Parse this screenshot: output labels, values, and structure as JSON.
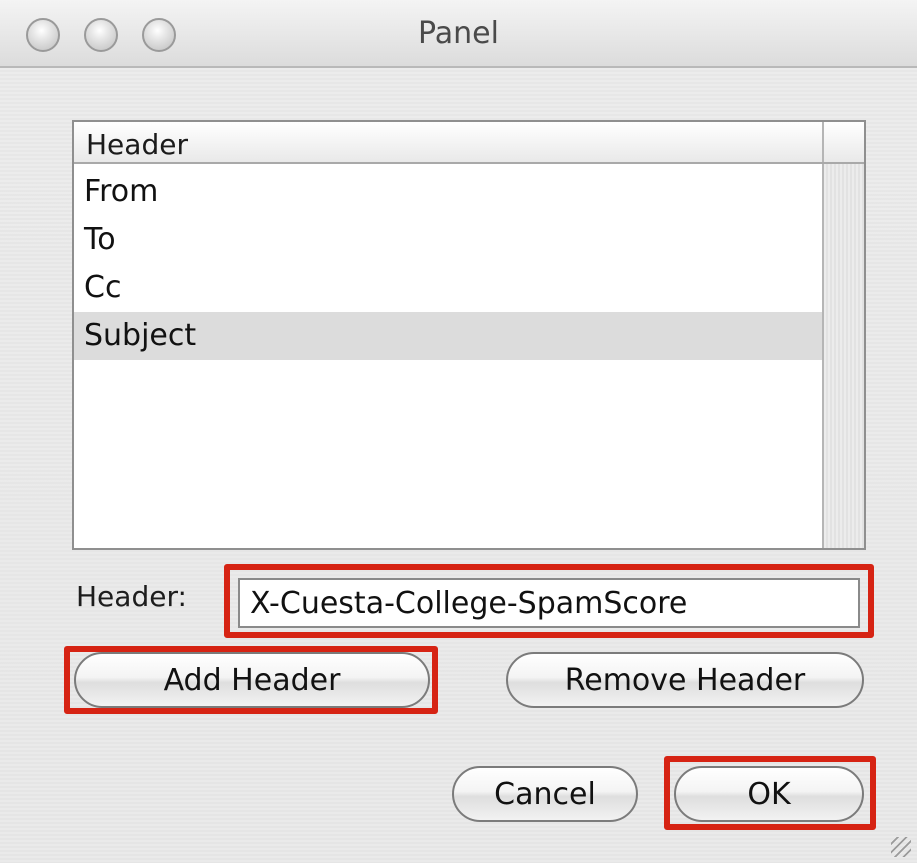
{
  "window": {
    "title": "Panel"
  },
  "table": {
    "column_header": "Header",
    "rows": [
      {
        "label": "From",
        "selected": false
      },
      {
        "label": "To",
        "selected": false
      },
      {
        "label": "Cc",
        "selected": false
      },
      {
        "label": "Subject",
        "selected": true
      }
    ]
  },
  "form": {
    "header_label": "Header:",
    "header_value": "X-Cuesta-College-SpamScore"
  },
  "buttons": {
    "add_header": "Add Header",
    "remove_header": "Remove Header",
    "cancel": "Cancel",
    "ok": "OK"
  },
  "colors": {
    "highlight": "#d62313",
    "selected_row": "#dcdcdc"
  }
}
